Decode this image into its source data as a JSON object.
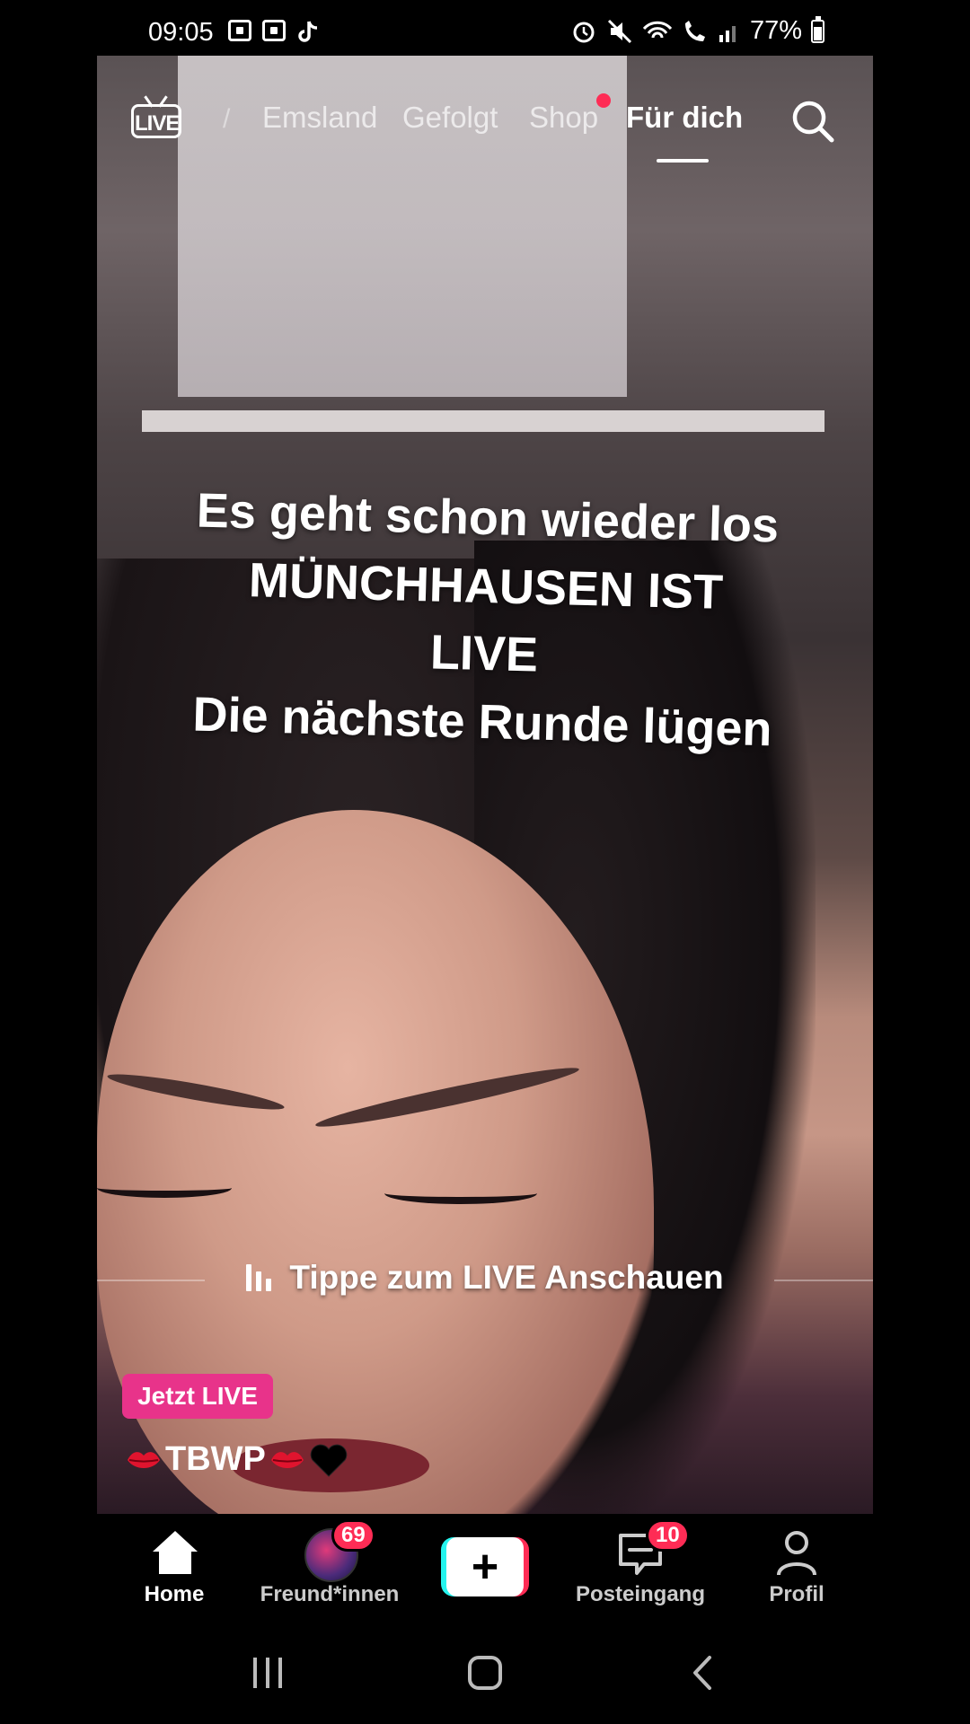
{
  "status_bar": {
    "time": "09:05",
    "battery": "77%"
  },
  "top_nav": {
    "live_label": "LIVE",
    "separator": "/",
    "tabs": [
      "Emsland",
      "Gefolgt",
      "Shop",
      "Für dich"
    ],
    "active_tab": "Für dich"
  },
  "video": {
    "caption_lines": [
      "Es geht schon wieder los",
      "MÜNCHHAUSEN IST",
      "LIVE",
      "Die nächste Runde lügen"
    ],
    "tap_hint": "Tippe zum LIVE Anschauen",
    "live_badge": "Jetzt LIVE",
    "username": "TBWP"
  },
  "bottom_nav": {
    "home": "Home",
    "friends": "Freund*innen",
    "friends_badge": "69",
    "inbox": "Posteingang",
    "inbox_badge": "10",
    "profile": "Profil",
    "create": "+"
  },
  "colors": {
    "accent": "#fe2c55",
    "live_badge": "#e8338a",
    "cyan": "#25f4ee"
  }
}
